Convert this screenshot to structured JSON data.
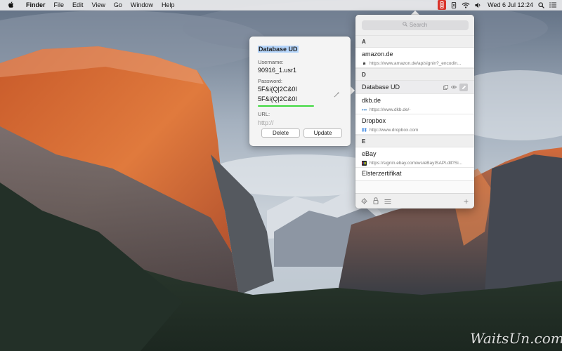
{
  "menubar": {
    "app_name": "Finder",
    "menus": [
      "File",
      "Edit",
      "View",
      "Go",
      "Window",
      "Help"
    ],
    "clock": "Wed 6 Jul  12:24",
    "status_icons": [
      "password-manager-icon",
      "dropbox-icon",
      "wifi-icon",
      "volume-icon",
      "search-icon",
      "notification-center-icon"
    ]
  },
  "popover": {
    "search_placeholder": "Search",
    "sections": [
      {
        "letter": "A",
        "entries": [
          {
            "name": "amazon.de",
            "url": "https://www.amazon.de/ap/signin?_encodin...",
            "icon": "amazon-icon"
          }
        ]
      },
      {
        "letter": "D",
        "entries": [
          {
            "name": "Database UD",
            "url": "",
            "selected": true
          },
          {
            "name": "dkb.de",
            "url": "https://www.dkb.de/-",
            "icon": "dkb-icon"
          },
          {
            "name": "Dropbox",
            "url": "http://www.dropbox.com",
            "icon": "dropbox-icon"
          }
        ]
      },
      {
        "letter": "E",
        "entries": [
          {
            "name": "eBay",
            "url": "https://signin.ebay.com/ws/eBayISAPI.dll?Si...",
            "icon": "ebay-icon"
          },
          {
            "name": "Elsterzertifikat",
            "url": ""
          }
        ]
      }
    ],
    "bottom_bar": {
      "add_label": "+"
    }
  },
  "detail": {
    "title": "Database UD",
    "username_label": "Username:",
    "username_value": "90916_1.usr1",
    "password_label": "Password:",
    "password_value": "5F&i{Q|2C&0I",
    "password_confirm": "5F&i{Q|2C&0I",
    "url_label": "URL:",
    "url_placeholder": "http://",
    "delete_label": "Delete",
    "update_label": "Update",
    "strength_color": "#3fd93f"
  },
  "watermark": "WaitsUn.com",
  "colors": {
    "status_red": "#d9342b",
    "selection_blue": "#b5d5fb"
  }
}
